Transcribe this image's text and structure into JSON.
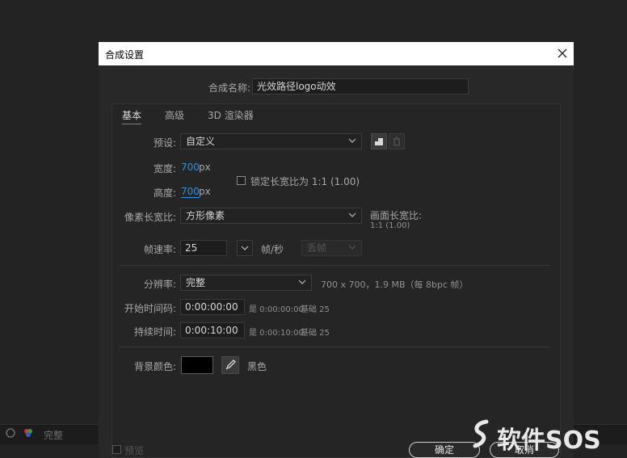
{
  "background": {
    "label": "完整"
  },
  "dialog": {
    "title": "合成设置",
    "name_label": "合成名称:",
    "name_value": "光效路径logo动效",
    "tabs": [
      {
        "label": "基本",
        "active": true
      },
      {
        "label": "高级",
        "active": false
      },
      {
        "label": "3D 渲染器",
        "active": false
      }
    ],
    "preset": {
      "label": "预设:",
      "value": "自定义"
    },
    "width": {
      "label": "宽度:",
      "value": "700",
      "unit": "px"
    },
    "height": {
      "label": "高度:",
      "value": "700",
      "unit": "px"
    },
    "lock_aspect": {
      "label": "锁定长宽比为 1:1 (1.00)",
      "checked": false
    },
    "pixel_aspect": {
      "label": "像素长宽比:",
      "value": "方形像素"
    },
    "frame_aspect": {
      "label": "画面长宽比:",
      "value": "1:1 (1.00)"
    },
    "frame_rate": {
      "label": "帧速率:",
      "value": "25",
      "unit": "帧/秒",
      "drop_frame": "丢帧"
    },
    "resolution": {
      "label": "分辨率:",
      "value": "完整",
      "info": "700 x 700，1.9 MB（每 8bpc 帧）"
    },
    "start_timecode": {
      "label": "开始时间码:",
      "value": "0:00:00:00",
      "equiv": "是 0:00:00:00",
      "base": "基础 25"
    },
    "duration": {
      "label": "持续时间:",
      "value": "0:00:10:00",
      "equiv": "是 0:00:10:00",
      "base": "基础 25"
    },
    "bg_color": {
      "label": "背景颜色:",
      "name": "黑色",
      "swatch": "#000000"
    },
    "preview_label": "预览",
    "ok_label": "确定",
    "cancel_label": "取消"
  },
  "watermark": "软件SOS",
  "colors": {
    "accent": "#2f8fe0",
    "dialog_bg": "#282828",
    "panel_bg": "#252525"
  }
}
